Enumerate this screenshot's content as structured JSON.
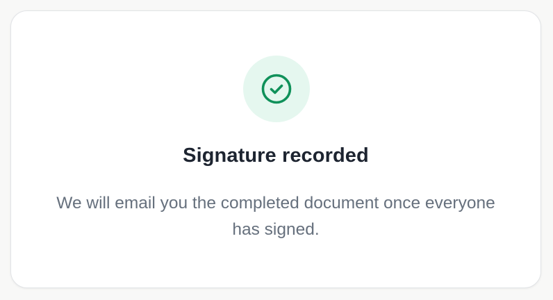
{
  "confirmation": {
    "icon": "check-circle-icon",
    "title": "Signature recorded",
    "message": "We will email you the completed document once everyone has signed."
  },
  "colors": {
    "accent": "#10915a",
    "icon_background": "#e5f7ef",
    "title": "#1d2430",
    "message": "#66707d"
  }
}
